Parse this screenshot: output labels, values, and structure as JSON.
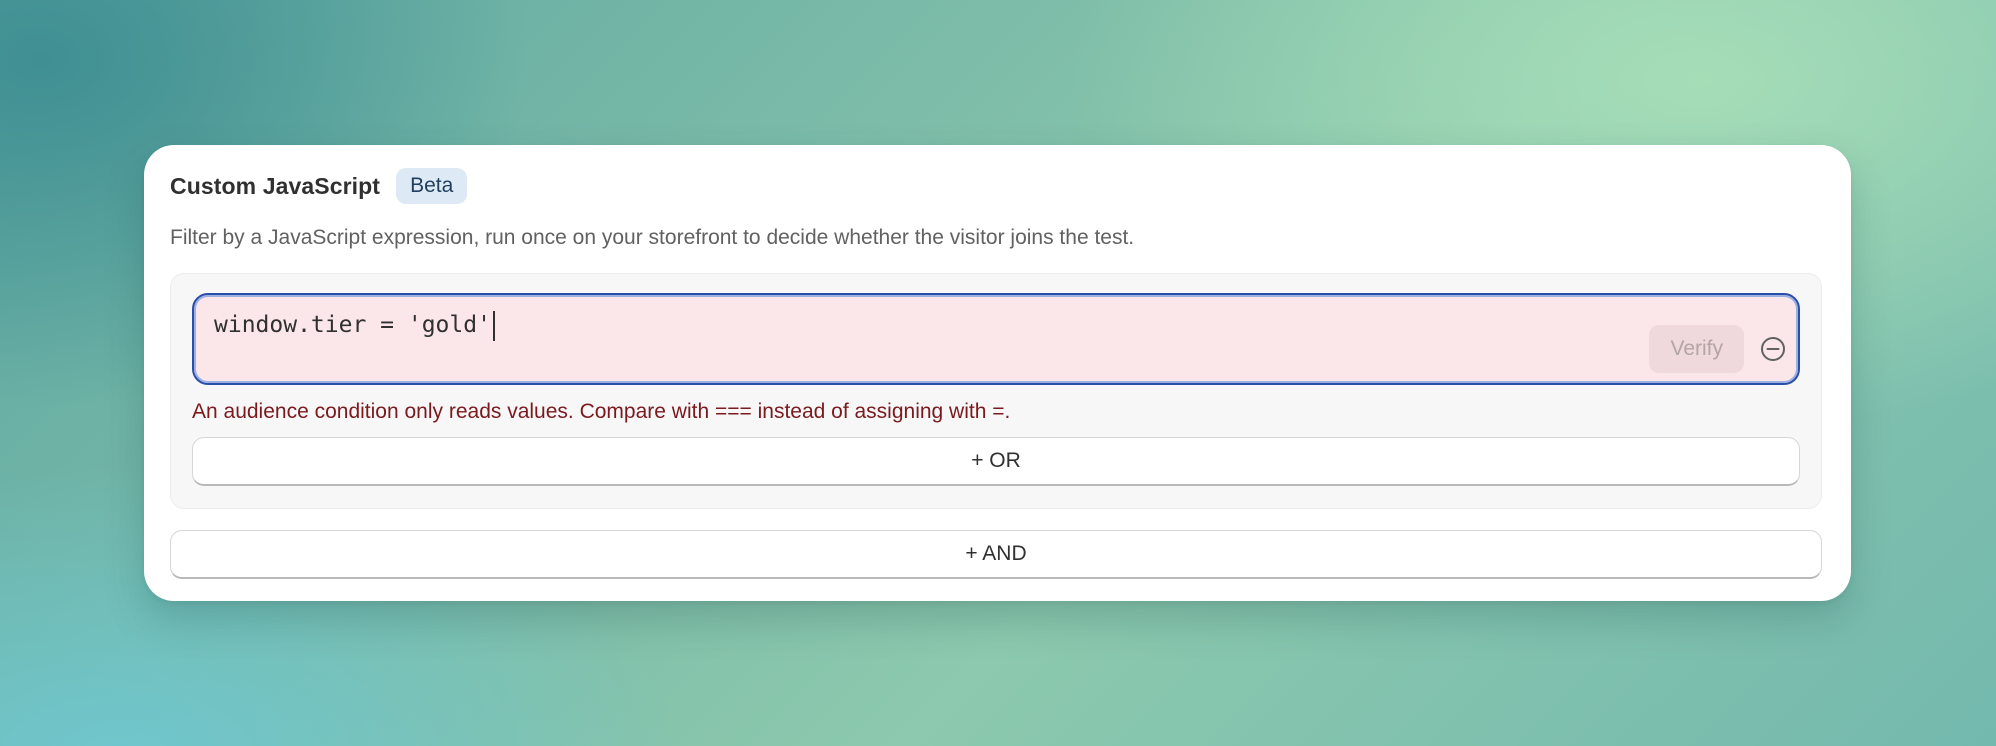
{
  "card": {
    "title": "Custom JavaScript",
    "badge": "Beta",
    "description": "Filter by a JavaScript expression, run once on your storefront to decide whether the visitor joins the test."
  },
  "editor": {
    "value": "window.tier = 'gold'",
    "verify_label": "Verify",
    "remove_icon": "minus-circle-icon",
    "error_text": "An audience condition only reads values. Compare with === instead of assigning with =."
  },
  "buttons": {
    "or_label": "+ OR",
    "and_label": "+ AND"
  },
  "colors": {
    "editor_error_bg": "#fbe7ea",
    "editor_focus_border": "#2a4fa8",
    "error_text": "#7a1a1f",
    "badge_bg": "#dde9f5"
  }
}
